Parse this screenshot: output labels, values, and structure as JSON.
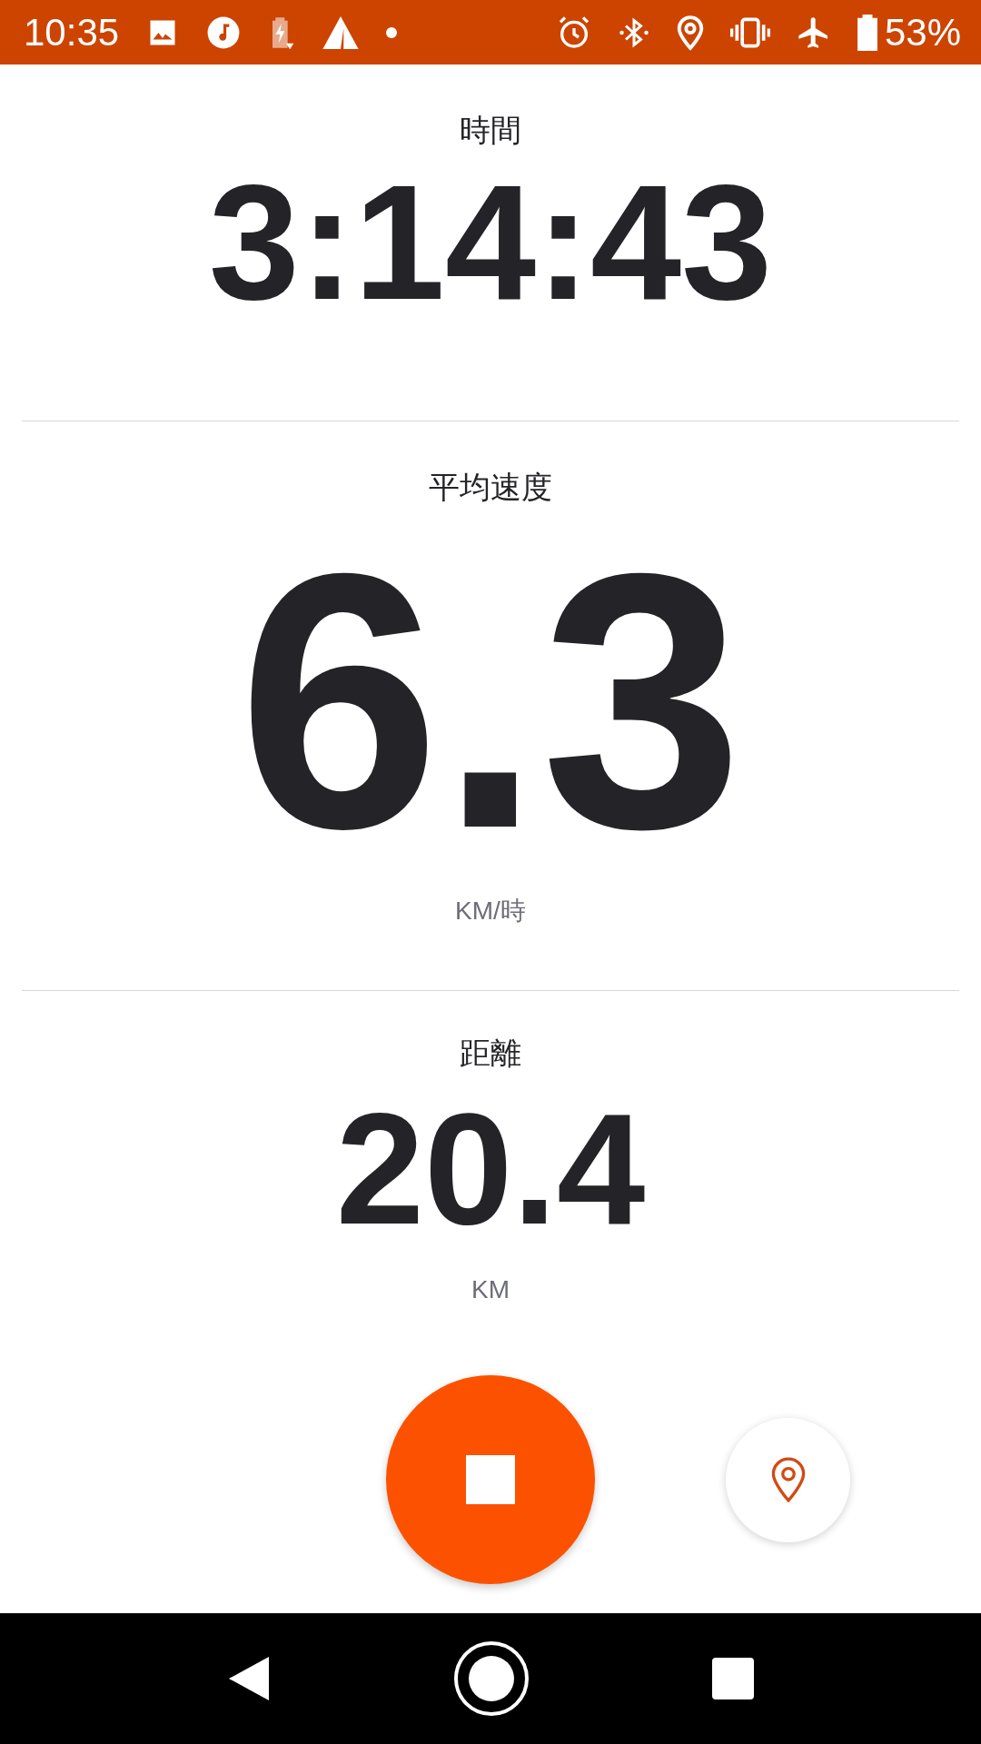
{
  "status_bar": {
    "time": "10:35",
    "battery": "53%"
  },
  "stats": [
    {
      "kind": "secondary",
      "label": "時間",
      "value": "3:14:43"
    },
    {
      "kind": "primary",
      "label": "平均速度",
      "value": "6.3",
      "unit": "KM/時"
    },
    {
      "kind": "tertiary",
      "label": "距離",
      "value": "20.4",
      "unit": "KM"
    }
  ]
}
